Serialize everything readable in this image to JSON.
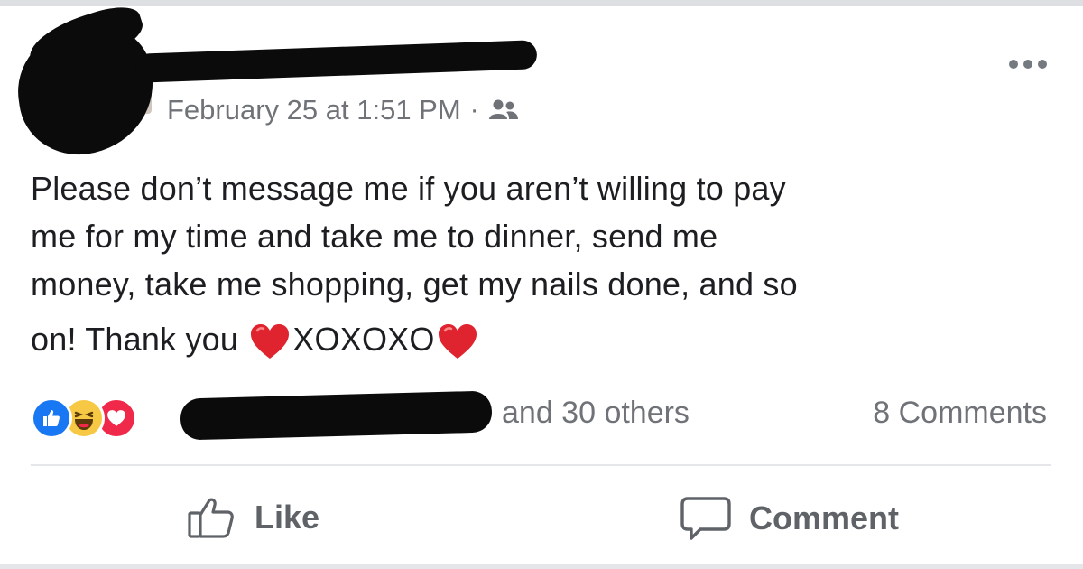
{
  "post": {
    "timestamp": "February 25 at 1:51 PM",
    "separator": "·",
    "audience_icon": "friends-icon",
    "body_lines": [
      "Please don’t message me if you aren’t willing to pay",
      "me for my time and take me to dinner, send me",
      "money, take me shopping, get my nails done, and so"
    ],
    "last_line_start": "on! Thank you ",
    "last_line_end": "XOXOXO",
    "emoji": "red-heart"
  },
  "engagement": {
    "reactions": [
      "like",
      "haha",
      "love"
    ],
    "others_text": "and 30 others",
    "comments_text": "8 Comments"
  },
  "actions": {
    "like_label": "Like",
    "comment_label": "Comment"
  },
  "colors": {
    "like_blue": "#1877f2",
    "haha_yellow": "#f7c843",
    "love_red": "#f0284a",
    "meta_gray": "#6f7378",
    "text": "#1c1e21"
  }
}
